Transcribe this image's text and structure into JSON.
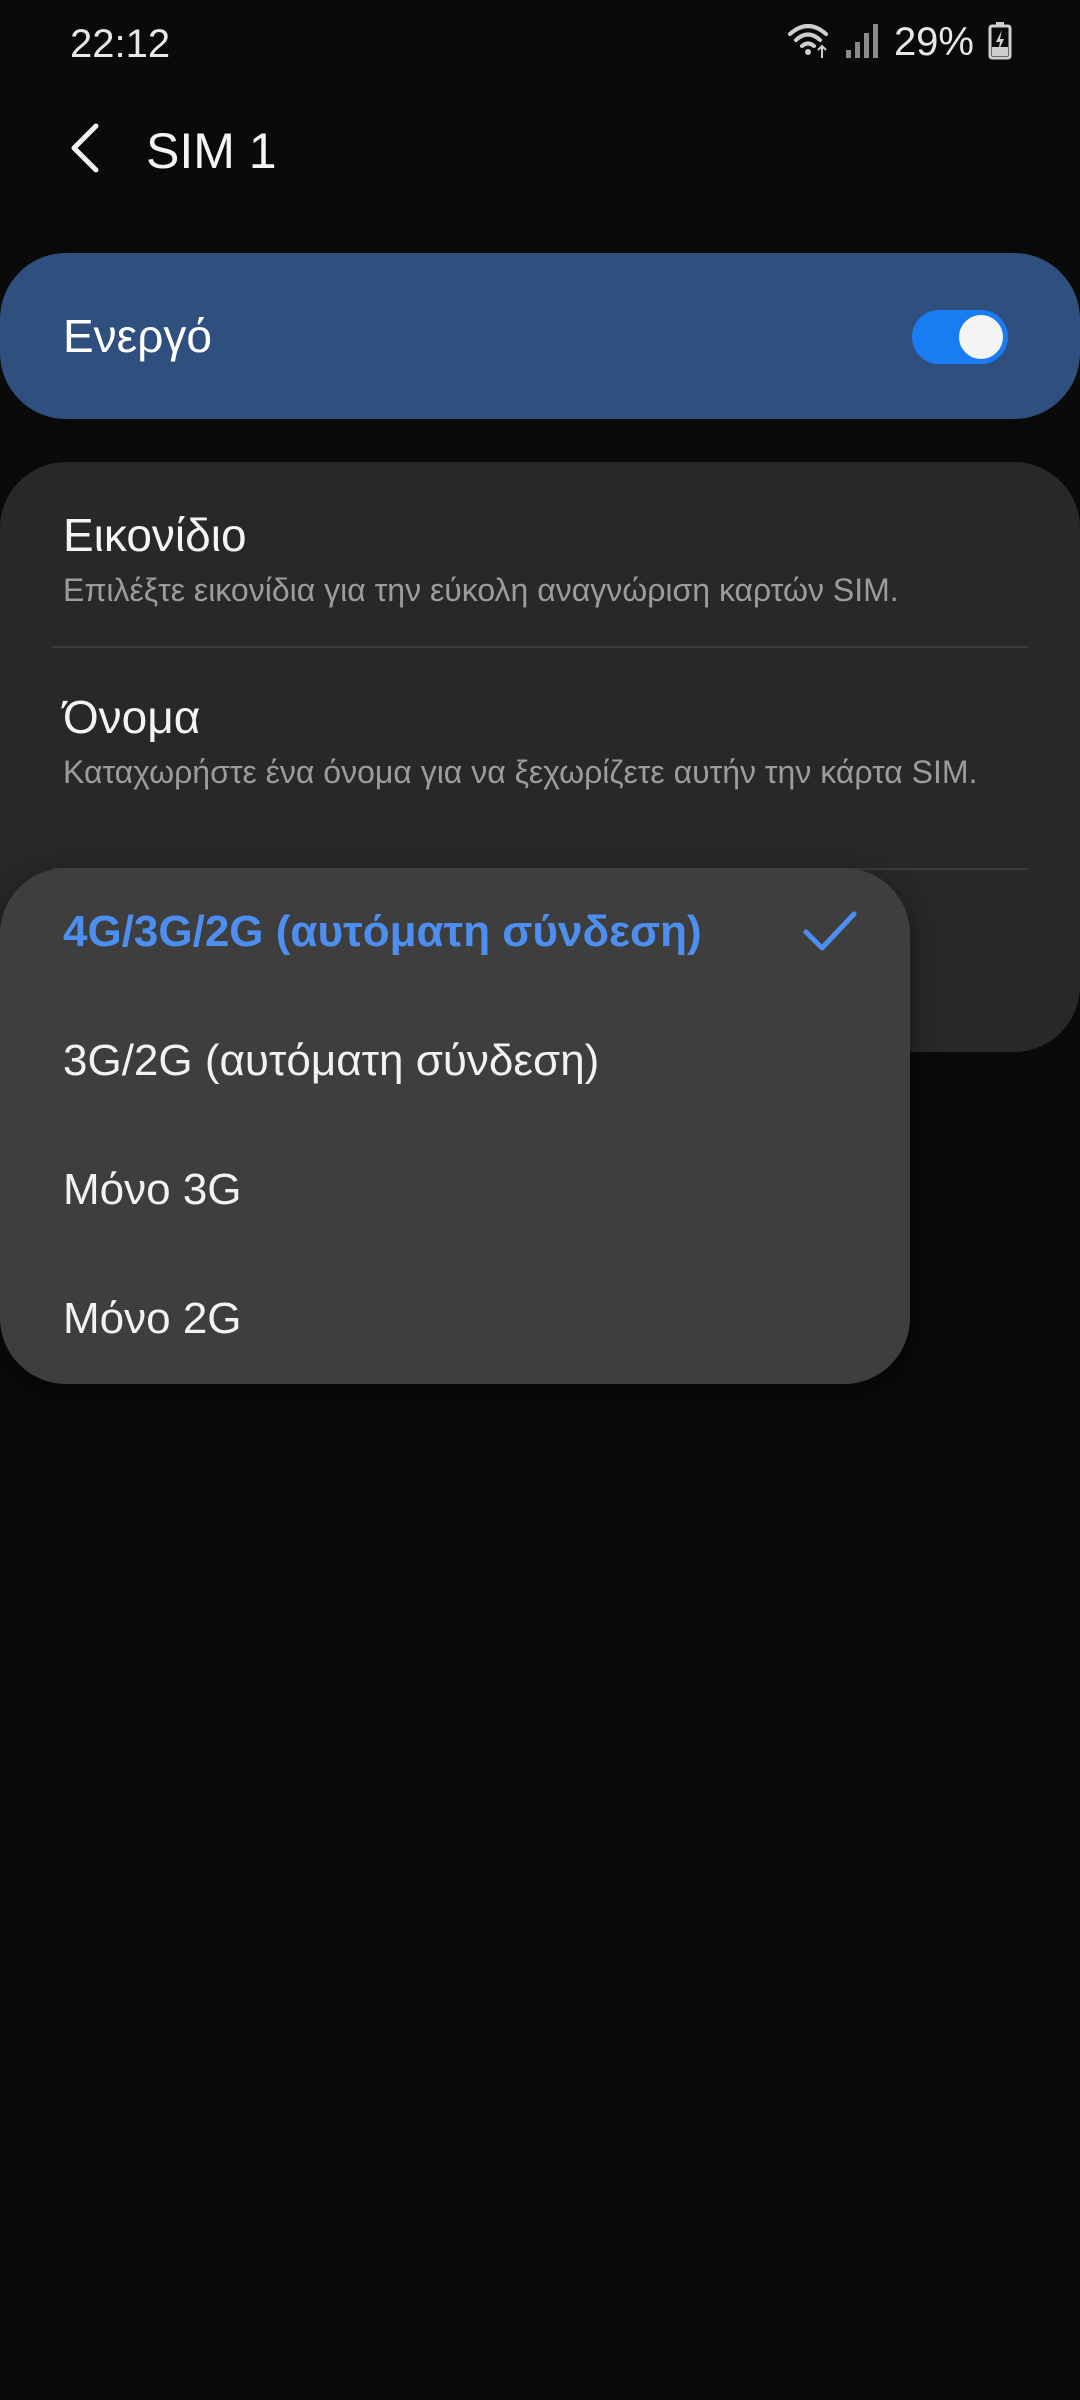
{
  "status_bar": {
    "time": "22:12",
    "battery_percent": "29%",
    "icons": [
      "wifi-icon",
      "signal-icon",
      "battery-charging-icon"
    ]
  },
  "header": {
    "title": "SIM 1",
    "back_icon": "chevron-left-icon"
  },
  "enabled_toggle": {
    "label": "Ενεργό",
    "state": true
  },
  "settings": {
    "icon_item": {
      "title": "Εικονίδιο",
      "subtitle": "Επιλέξτε εικονίδια για την εύκολη αναγνώριση καρτών SIM."
    },
    "name_item": {
      "title": "Όνομα",
      "subtitle": "Καταχωρήστε ένα όνομα για να ξεχωρίζετε αυτήν την κάρτα SIM."
    }
  },
  "network_mode_popup": {
    "options": [
      {
        "label": "4G/3G/2G (αυτόματη σύνδεση)",
        "selected": true
      },
      {
        "label": "3G/2G (αυτόματη σύνδεση)",
        "selected": false
      },
      {
        "label": "Μόνο 3G",
        "selected": false
      },
      {
        "label": "Μόνο 2G",
        "selected": false
      }
    ]
  },
  "colors": {
    "background": "#0a0a0a",
    "toggle_card": "#2f4f7f",
    "accent": "#1a7cf2",
    "selected_text": "#4d8ff0",
    "card": "#282828",
    "popup": "#3e3e3e"
  }
}
